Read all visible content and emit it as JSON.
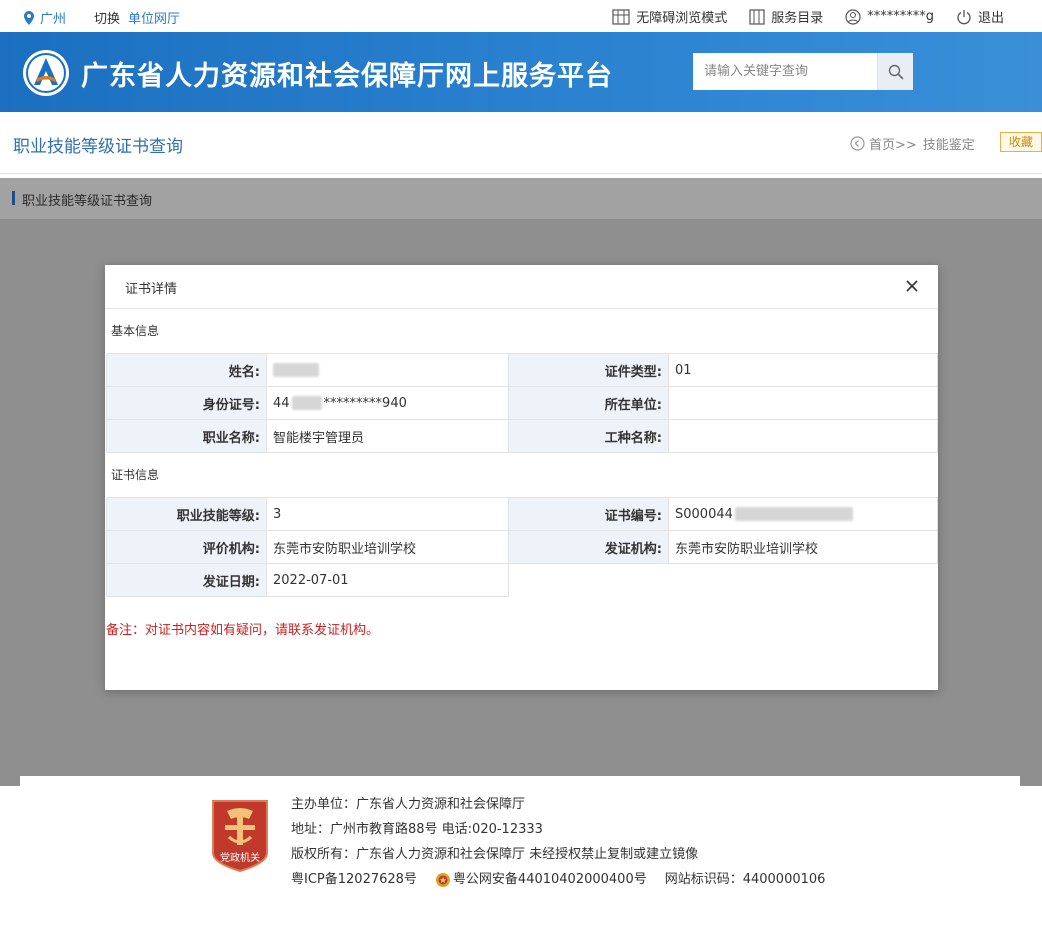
{
  "topbar": {
    "city": "广州",
    "switch_label": "切换",
    "unit_hall": "单位网厅",
    "accessibility": "无障碍浏览模式",
    "service_directory": "服务目录",
    "username": "*********g",
    "logout": "退出"
  },
  "header": {
    "title": "广东省人力资源和社会保障厅网上服务平台",
    "search_placeholder": "请输入关键字查询"
  },
  "page": {
    "title": "职业技能等级证书查询",
    "breadcrumb_home": "首页>>",
    "breadcrumb_current": "技能鉴定",
    "favorite": "收藏",
    "panel_title": "职业技能等级证书查询"
  },
  "modal": {
    "title": "证书详情",
    "basic_section": "基本信息",
    "cert_section": "证书信息",
    "basic_rows": [
      {
        "k1": "姓名:",
        "v1": "",
        "k2": "证件类型:",
        "v2": "01"
      },
      {
        "k1": "身份证号:",
        "v1_prefix": "44",
        "v1_suffix": "*********940",
        "k2": "所在单位:",
        "v2": ""
      },
      {
        "k1": "职业名称:",
        "v1": "智能楼宇管理员",
        "k2": "工种名称:",
        "v2": ""
      }
    ],
    "cert_rows": [
      {
        "k1": "职业技能等级:",
        "v1": "3",
        "k2": "证书编号:",
        "v2": "S000044"
      },
      {
        "k1": "评价机构:",
        "v1": "东莞市安防职业培训学校",
        "k2": "发证机构:",
        "v2": "东莞市安防职业培训学校"
      },
      {
        "k1": "发证日期:",
        "v1": "2022-07-01"
      }
    ],
    "note": "备注：对证书内容如有疑问，请联系发证机构。"
  },
  "footer": {
    "badge_text": "党政机关",
    "sponsor": "主办单位：广东省人力资源和社会保障厅",
    "address": "地址：广州市教育路88号 电话:020-12333",
    "copyright": "版权所有：广东省人力资源和社会保障厅 未经授权禁止复制或建立镜像",
    "icp": "粤ICP备12027628号",
    "police": "粤公网安备44010402000400号",
    "site_code": "网站标识码：4400000106"
  },
  "colors": {
    "header_blue": "#1c6fc0",
    "link_blue": "#2b7bc6",
    "note_red": "#cc2020",
    "badge_red": "#c0392b"
  }
}
